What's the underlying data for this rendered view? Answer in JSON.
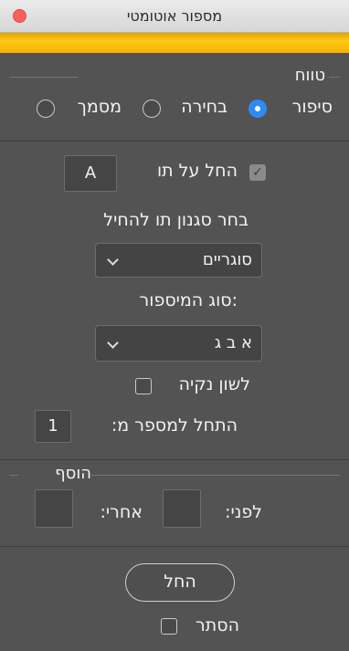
{
  "window": {
    "title": "מספור אוטומטי"
  },
  "range": {
    "legend": "טווח",
    "options": [
      {
        "label": "סיפור",
        "selected": true
      },
      {
        "label": "בחירה",
        "selected": false
      },
      {
        "label": "מסמך",
        "selected": false
      }
    ]
  },
  "start_at": {
    "label": "החל על תו",
    "checked": true,
    "value": "A"
  },
  "style": {
    "label": "בחר סגנון תו להחיל",
    "selected": "סוגריים"
  },
  "number_type": {
    "label": ":סוג המיספור",
    "selected": "א ב ג"
  },
  "clean_language": {
    "label": "לשון נקיה",
    "checked": false
  },
  "start_number": {
    "label": "התחל למספר מ:",
    "value": "1"
  },
  "add": {
    "legend": "הוסף",
    "before_label": "לפני:",
    "before_value": "",
    "after_label": "אחרי:",
    "after_value": ""
  },
  "apply_button": "החל",
  "hide": {
    "label": "הסתר",
    "checked": false
  },
  "colors": {
    "accent": "#ffc81a",
    "panel": "#535353",
    "radio_selected": "#2f8af5"
  }
}
